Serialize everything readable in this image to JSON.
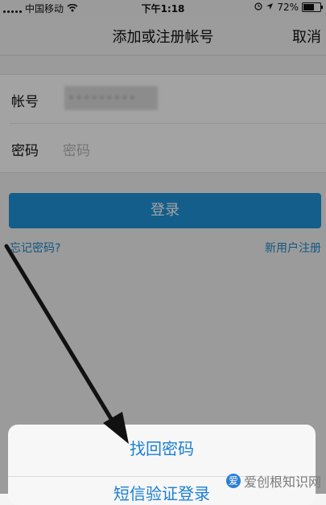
{
  "status": {
    "carrier": "中国移动",
    "time": "下午1:18",
    "battery": "72%",
    "battery_level": 0.72
  },
  "nav": {
    "title": "添加或注册帐号",
    "cancel": "取消"
  },
  "form": {
    "account_label": "帐号",
    "account_value": "•••••••••",
    "password_label": "密码",
    "password_placeholder": "密码"
  },
  "login_button": "登录",
  "links": {
    "forgot": "忘记密码?",
    "register": "新用户注册"
  },
  "sheet": {
    "item1": "找回密码",
    "item2": "短信验证登录"
  },
  "watermark": {
    "logo": "爱",
    "text": "爱创根知识网"
  },
  "colors": {
    "accent": "#1f93d8",
    "link": "#1f88cc"
  }
}
